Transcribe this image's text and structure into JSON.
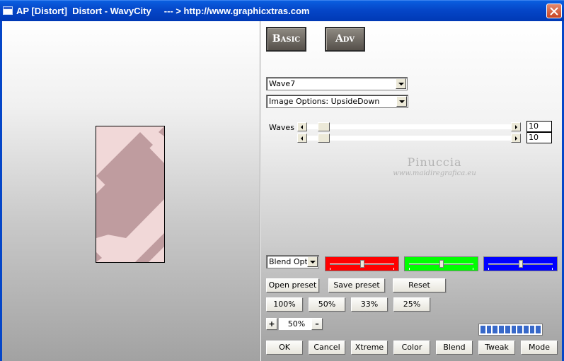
{
  "window": {
    "title": "AP [Distort]  Distort - WavyCity     --- > http://www.graphicxtras.com"
  },
  "tabs": {
    "basic": "Basic",
    "adv": "Adv"
  },
  "effect_select": {
    "value": "Wave7"
  },
  "image_options_select": {
    "value": "Image Options: UpsideDown"
  },
  "waves": {
    "label": "Waves",
    "slider1_value": "10",
    "slider2_value": "10",
    "slider1_fraction": 0.1,
    "slider2_fraction": 0.1
  },
  "watermark": {
    "name": "Pinuccia",
    "site": "www.maidiregrafica.eu"
  },
  "blend_select": {
    "value": "Blend Optio"
  },
  "color_channels": [
    {
      "name": "red",
      "color": "#ff0000",
      "fraction": 0.5
    },
    {
      "name": "green",
      "color": "#00ff00",
      "fraction": 0.5
    },
    {
      "name": "blue",
      "color": "#0000ff",
      "fraction": 0.5
    }
  ],
  "preset_buttons": {
    "open": "Open preset",
    "save": "Save preset",
    "reset": "Reset"
  },
  "zoom_buttons": [
    "100%",
    "50%",
    "33%",
    "25%"
  ],
  "zoom": {
    "plus": "+",
    "value": "50%",
    "minus": "–"
  },
  "progress": {
    "segments": 10,
    "filled": 10
  },
  "bottom_buttons": [
    "OK",
    "Cancel",
    "Xtreme",
    "Color",
    "Blend",
    "Tweak",
    "Mode"
  ],
  "colors": {
    "title_bar": "#0546c8",
    "thumb_light": "#f1d8d8",
    "thumb_dark": "#bf9c9f"
  }
}
